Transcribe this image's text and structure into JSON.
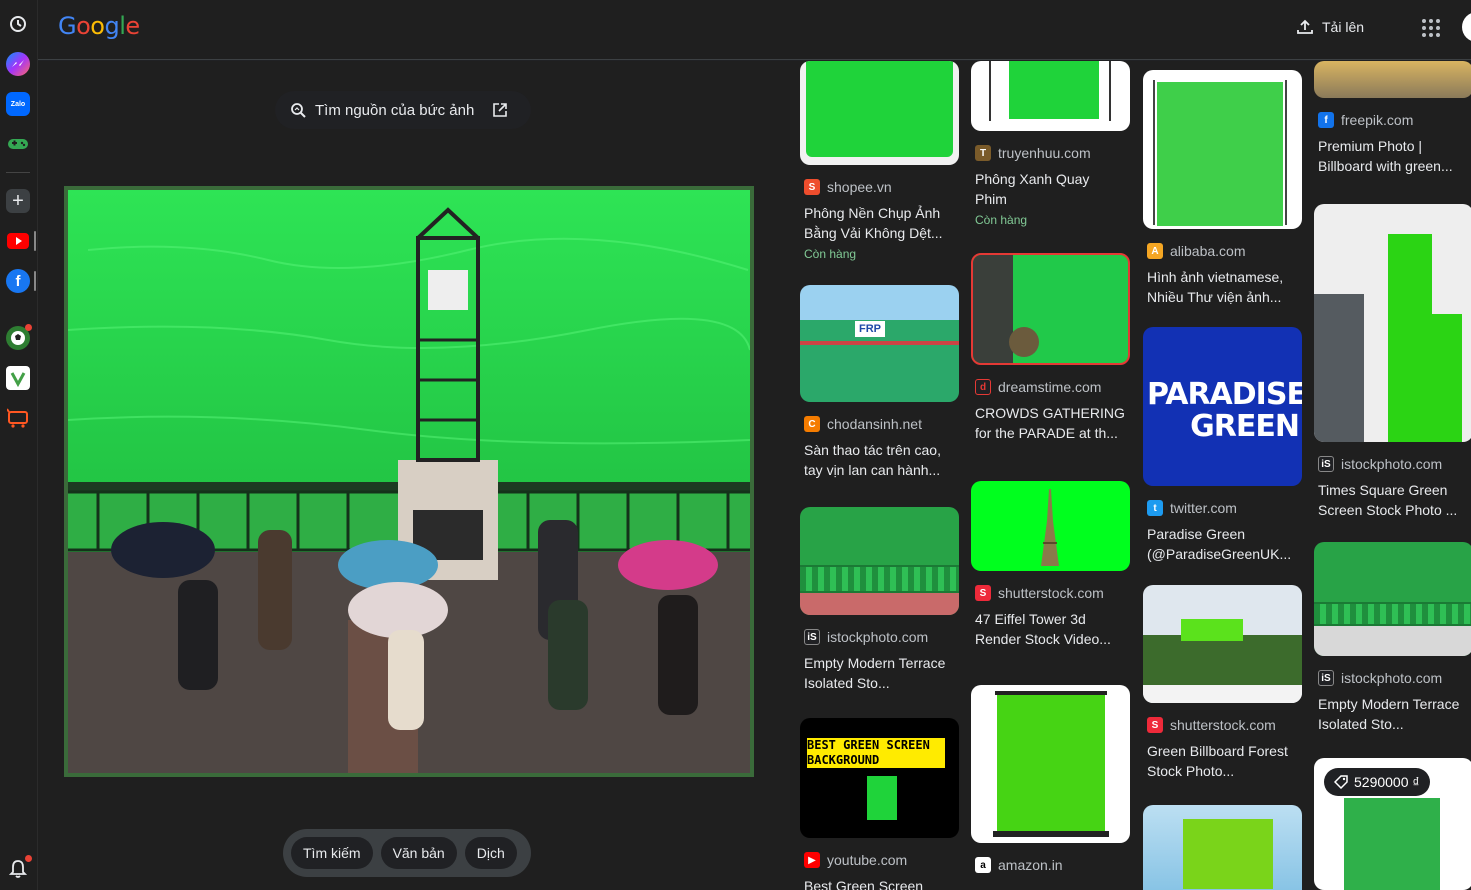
{
  "header": {
    "logo": "Google",
    "upload_label": "Tải lên"
  },
  "lens": {
    "find_source_label": "Tìm nguồn của bức ảnh",
    "tabs": [
      "Tìm kiếm",
      "Văn bản",
      "Dịch"
    ]
  },
  "sidebar": {
    "icons": [
      "history-icon",
      "messenger-icon",
      "zalo-icon",
      "gamepad-icon",
      "add-icon",
      "youtube-icon",
      "facebook-icon",
      "soccer-icon",
      "app-icon",
      "shop-icon",
      "notifications-icon"
    ],
    "zalo_text": "Zalo"
  },
  "results": [
    {
      "source": "shopee.vn",
      "title": "Phông Nền Chụp Ảnh Bằng Vải Không Dệt...",
      "stock": "Còn hàng"
    },
    {
      "source": "chodansinh.net",
      "title": "Sàn thao tác trên cao, tay vịn lan can hành...",
      "thumb_text": "FRP"
    },
    {
      "source": "istockphoto.com",
      "title": "Empty Modern Terrace Isolated Sto..."
    },
    {
      "source": "youtube.com",
      "title": "Best Green Screen",
      "thumb_text": "BEST GREEN SCREEN BACKGROUND"
    },
    {
      "source": "truyenhuu.com",
      "title": "Phông Xanh Quay Phim",
      "stock": "Còn hàng"
    },
    {
      "source": "dreamstime.com",
      "title": "CROWDS GATHERING for the PARADE at th..."
    },
    {
      "source": "shutterstock.com",
      "title": "47 Eiffel Tower 3d Render Stock Video..."
    },
    {
      "source": "amazon.in",
      "title": ""
    },
    {
      "source": "alibaba.com",
      "title": "Hình ảnh vietnamese, Nhiều Thư viện ảnh..."
    },
    {
      "source": "twitter.com",
      "title": "Paradise Green (@ParadiseGreenUK...",
      "thumb_text": "PARADISE GREEN"
    },
    {
      "source": "shutterstock.com",
      "title": "Green Billboard Forest Stock Photo..."
    },
    {
      "source": "freepik.com",
      "title": "Premium Photo | Billboard with green..."
    },
    {
      "source": "istockphoto.com",
      "title": "Times Square Green Screen Stock Photo ..."
    },
    {
      "source": "istockphoto.com",
      "title": "Empty Modern Terrace Isolated Sto..."
    },
    {
      "source": "",
      "title": "",
      "price": "5290000 ₫"
    }
  ]
}
